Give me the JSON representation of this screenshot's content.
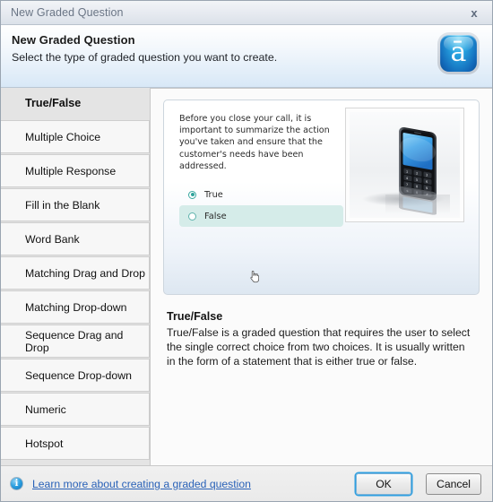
{
  "window": {
    "title": "New Graded Question",
    "close_icon": "close-icon",
    "close_glyph": "x"
  },
  "header": {
    "title": "New Graded Question",
    "subtitle": "Select the type of graded question you want to create.",
    "logo_icon": "articulate-logo-icon",
    "logo_glyph": "ā"
  },
  "sidebar": {
    "items": [
      {
        "label": "True/False",
        "selected": true
      },
      {
        "label": "Multiple Choice",
        "selected": false
      },
      {
        "label": "Multiple Response",
        "selected": false
      },
      {
        "label": "Fill in the Blank",
        "selected": false
      },
      {
        "label": "Word Bank",
        "selected": false
      },
      {
        "label": "Matching Drag and Drop",
        "selected": false
      },
      {
        "label": "Matching Drop-down",
        "selected": false
      },
      {
        "label": "Sequence Drag and Drop",
        "selected": false
      },
      {
        "label": "Sequence Drop-down",
        "selected": false
      },
      {
        "label": "Numeric",
        "selected": false
      },
      {
        "label": "Hotspot",
        "selected": false
      }
    ]
  },
  "preview": {
    "question_text": "Before you close your call, it is important to summarize the action you've taken and ensure that the customer's needs have been addressed.",
    "choices": [
      {
        "label": "True",
        "checked": true,
        "hovered": false
      },
      {
        "label": "False",
        "checked": false,
        "hovered": true
      }
    ],
    "image_icon": "mobile-phone-image",
    "cursor_icon": "hand-pointer-cursor"
  },
  "description": {
    "title": "True/False",
    "body": "True/False is a graded question that requires the user to select the single correct choice from two choices.  It is usually written in the form of a statement that is either true or false."
  },
  "footer": {
    "info_icon": "info-icon",
    "info_glyph": "i",
    "learn_more_label": "Learn more about creating a graded question",
    "ok_label": "OK",
    "cancel_label": "Cancel"
  },
  "colors": {
    "accent_blue": "#2f9fe0",
    "link_blue": "#2a62b8",
    "choice_highlight": "#d5ece9",
    "radio_teal": "#2fa39b"
  }
}
